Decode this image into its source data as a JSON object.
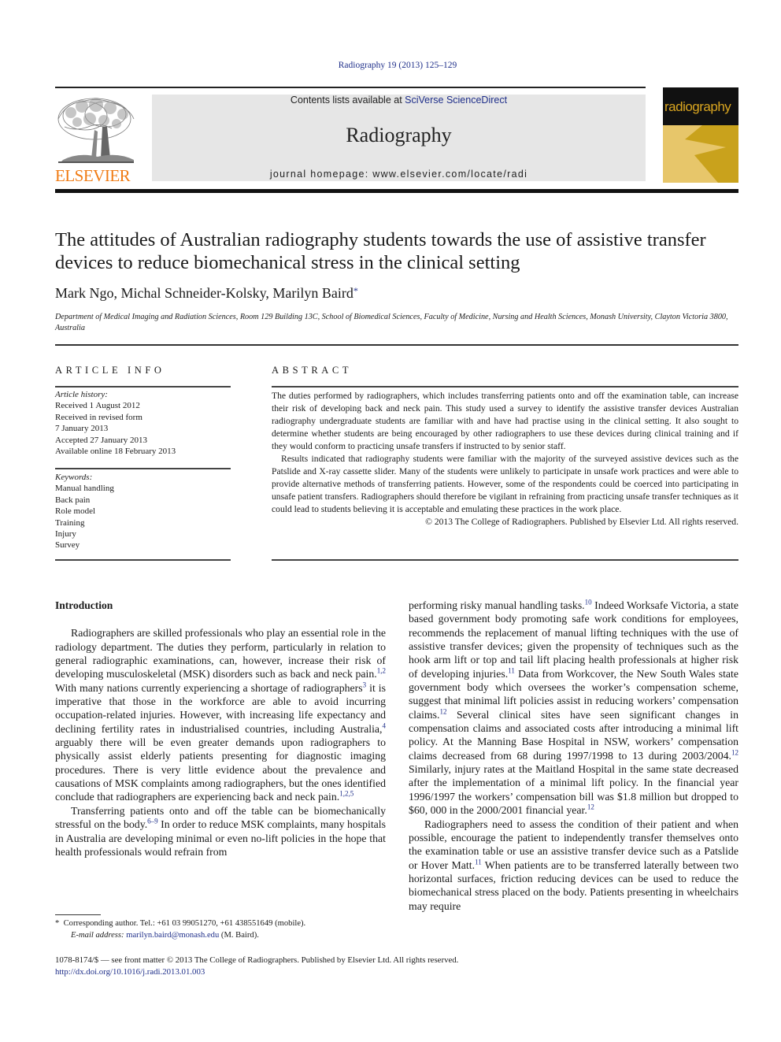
{
  "header": {
    "citation": "Radiography 19 (2013) 125–129",
    "contents_prefix": "Contents lists available at ",
    "contents_link": "SciVerse ScienceDirect",
    "journal_name": "Radiography",
    "homepage_prefix": "journal homepage: ",
    "homepage_url": "www.elsevier.com/locate/radi",
    "publisher_logo_text": "ELSEVIER",
    "cover_title": "radiography",
    "colors": {
      "link": "#1f2f8a",
      "elsevier_orange": "#f07b13",
      "cover_gold": "#c9a21c",
      "masthead_gray": "#e6e6e6"
    }
  },
  "article": {
    "title": "The attitudes of Australian radiography students towards the use of assistive transfer devices to reduce biomechanical stress in the clinical setting",
    "authors": "Mark Ngo, Michal Schneider-Kolsky, Marilyn Baird",
    "corresponding_marker": "*",
    "affiliation": "Department of Medical Imaging and Radiation Sciences, Room 129 Building 13C, School of Biomedical Sciences, Faculty of Medicine, Nursing and Health Sciences, Monash University, Clayton Victoria 3800, Australia"
  },
  "article_info": {
    "heading": "ARTICLE INFO",
    "history_label": "Article history:",
    "history": [
      "Received 1 August 2012",
      "Received in revised form",
      "7 January 2013",
      "Accepted 27 January 2013",
      "Available online 18 February 2013"
    ],
    "keywords_label": "Keywords:",
    "keywords": [
      "Manual handling",
      "Back pain",
      "Role model",
      "Training",
      "Injury",
      "Survey"
    ]
  },
  "abstract": {
    "heading": "ABSTRACT",
    "paragraphs": [
      "The duties performed by radiographers, which includes transferring patients onto and off the exami­nation table, can increase their risk of developing back and neck pain. This study used a survey to identify the assistive transfer devices Australian radiography undergraduate students are familiar with and have had practise using in the clinical setting. It also sought to determine whether students are being encouraged by other radiographers to use these devices during clinical training and if they would conform to practicing unsafe transfers if instructed to by senior staff.",
      "Results indicated that radiography students were familiar with the majority of the surveyed assistive devices such as the Patslide and X-ray cassette slider. Many of the students were unlikely to participate in unsafe work practices and were able to provide alternative methods of transferring patients. However, some of the respondents could be coerced into participating in unsafe patient transfers. Radiographers should therefore be vigilant in refraining from practicing unsafe transfer techniques as it could lead to students believing it is acceptable and emulating these practices in the work place."
    ],
    "copyright": "© 2013 The College of Radiographers. Published by Elsevier Ltd. All rights reserved."
  },
  "body": {
    "section_heading": "Introduction",
    "left": {
      "p1": [
        {
          "t": "Radiographers are skilled professionals who play an essential role in the radiology department. The duties they perform, partic­ularly in relation to general radiographic examinations, can, how­ever, increase their risk of developing musculoskeletal (MSK) disorders such as back and neck pain."
        },
        {
          "ref": "1,2"
        },
        {
          "t": " With many nations currently experiencing a shortage of radiographers"
        },
        {
          "ref": "3"
        },
        {
          "t": " it is imperative that those in the workforce are able to avoid incurring occupation-related in­juries. However, with increasing life expectancy and declining fer­tility rates in industrialised countries, including Australia,"
        },
        {
          "ref": "4"
        },
        {
          "t": " arguably there will be even greater demands upon radiographers to physically assist elderly patients presenting for diagnostic imaging procedures. There is very little evidence about the prevalence and causations of MSK complaints among radiographers, but the ones identified conclude that radiographers are experiencing back and neck pain."
        },
        {
          "ref": "1,2,5"
        }
      ],
      "p2": [
        {
          "t": "Transferring patients onto and off the table can be biomechani­cally stressful on the body."
        },
        {
          "ref": "6–9"
        },
        {
          "t": " In order to reduce MSK complaints, many hospitals in Australia are developing minimal or even no-lift policies in the hope that health professionals would refrain from"
        }
      ]
    },
    "right": {
      "p1": [
        {
          "t": "performing risky manual handling tasks."
        },
        {
          "ref": "10"
        },
        {
          "t": " Indeed Worksafe Victo­ria, a state based government body promoting safe work conditions for employees, recommends the replacement of manual lifting techniques with the use of assistive transfer devices; given the propensity of techniques such as the hook arm lift or top and tail lift placing health professionals at higher risk of developing injuries."
        },
        {
          "ref": "11"
        },
        {
          "t": " Data from Workcover, the New South Wales state government body which oversees the worker’s compensation scheme, suggest that minimal lift policies assist in reducing workers’ compensation claims."
        },
        {
          "ref": "12"
        },
        {
          "t": " Several clinical sites have seen significant changes in compensation claims and associated costs after introducing a min­imal lift policy. At the Manning Base Hospital in NSW, workers’ compensation claims decreased from 68 during 1997/1998 to 13 during 2003/2004."
        },
        {
          "ref": "12"
        },
        {
          "t": " Similarly, injury rates at the Maitland Hospital in the same state decreased after the implementation of a minimal lift policy. In the financial year 1996/1997 the workers’ compensa­tion bill was $1.8 million but dropped to $60, 000 in the 2000/2001 financial year."
        },
        {
          "ref": "12"
        }
      ],
      "p2": [
        {
          "t": "Radiographers need to assess the condition of their patient and when possible, encourage the patient to independently transfer themselves onto the examination table or use an assistive transfer device such as a Patslide or Hover Matt."
        },
        {
          "ref": "11"
        },
        {
          "t": " When patients are to be transferred laterally between two horizontal surfaces, friction reducing devices can be used to reduce the biomechanical stress placed on the body. Patients presenting in wheelchairs may require"
        }
      ]
    }
  },
  "footnote": {
    "marker": "*",
    "corresponding": "Corresponding author. Tel.: +61 03 99051270, +61 438551649 (mobile).",
    "email_label": "E-mail address:",
    "email": "marilyn.baird@monash.edu",
    "email_suffix": " (M. Baird)."
  },
  "bottom": {
    "front_matter": "1078-8174/$ — see front matter © 2013 The College of Radiographers. Published by Elsevier Ltd. All rights reserved.",
    "doi": "http://dx.doi.org/10.1016/j.radi.2013.01.003"
  }
}
